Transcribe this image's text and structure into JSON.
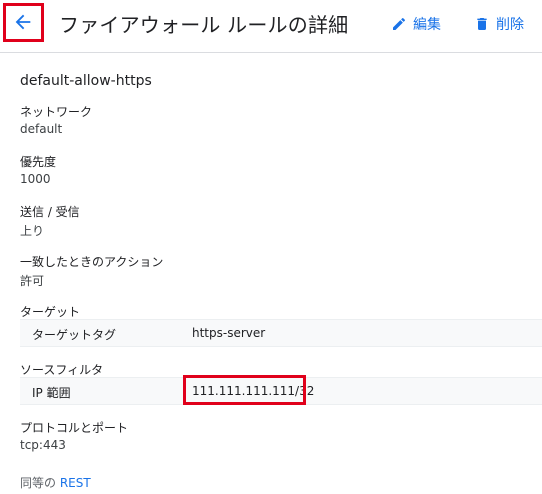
{
  "header": {
    "title": "ファイアウォール ルールの詳細",
    "edit_label": "編集",
    "delete_label": "削除",
    "accent_color": "#1a73e8",
    "annotation_color": "#e0001b"
  },
  "rule": {
    "name": "default-allow-https",
    "network": {
      "label": "ネットワーク",
      "value": "default"
    },
    "priority": {
      "label": "優先度",
      "value": "1000"
    },
    "direction": {
      "label": "送信 / 受信",
      "value": "上り"
    },
    "action": {
      "label": "一致したときのアクション",
      "value": "許可"
    },
    "targets": {
      "label": "ターゲット",
      "row_key": "ターゲットタグ",
      "row_value": "https-server"
    },
    "source_filter": {
      "label": "ソースフィルタ",
      "row_key": "IP 範囲",
      "row_value": "111.111.111.111/32"
    },
    "protocols": {
      "label": "プロトコルとポート",
      "value": "tcp:443"
    }
  },
  "footer": {
    "equivalent_prefix": "同等の",
    "rest_link": "REST"
  },
  "icons": {
    "back": "arrow-back-icon",
    "edit": "pencil-icon",
    "delete": "trash-icon"
  }
}
